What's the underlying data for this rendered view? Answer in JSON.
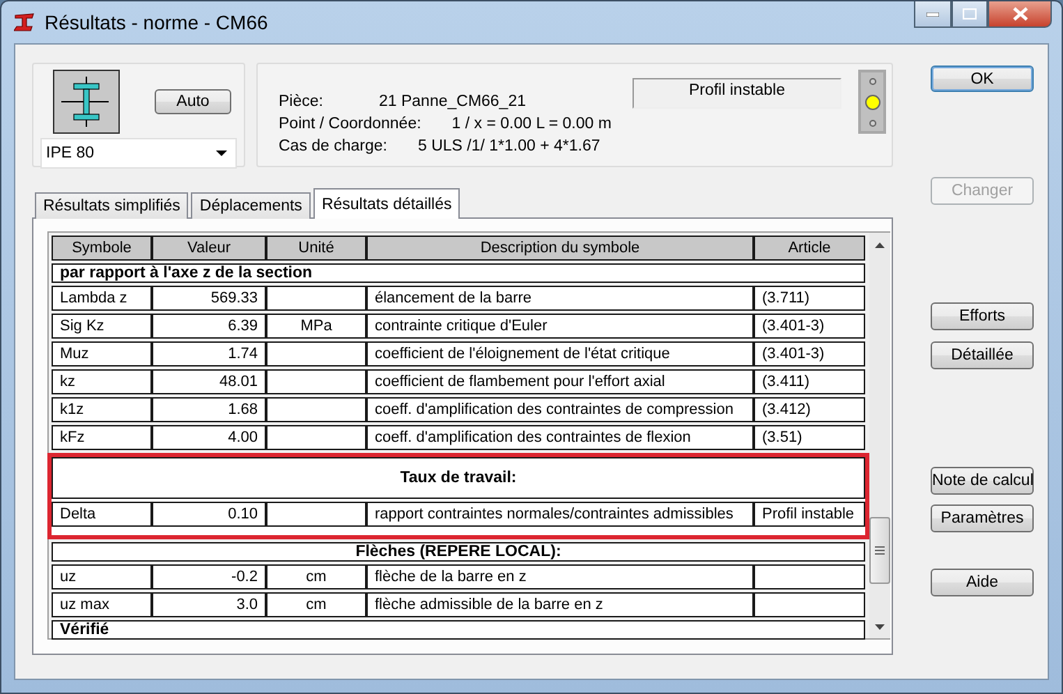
{
  "window": {
    "title": "Résultats - norme - CM66"
  },
  "section": {
    "profile": "IPE 80",
    "auto_button": "Auto"
  },
  "info": [
    {
      "label": "Pièce:",
      "value": "21  Panne_CM66_21"
    },
    {
      "label": "Point / Coordonnée:",
      "value": "1 / x = 0.00 L = 0.00 m"
    },
    {
      "label": "Cas de charge:",
      "value": "5 ULS /1/  1*1.00 + 4*1.67"
    }
  ],
  "status_text": "Profil instable",
  "indicator": [
    {
      "on": false
    },
    {
      "on": true
    },
    {
      "on": false
    }
  ],
  "tabs": [
    {
      "label": "Résultats simplifiés",
      "selected": false
    },
    {
      "label": "Déplacements",
      "selected": false
    },
    {
      "label": "Résultats détaillés",
      "selected": true
    }
  ],
  "table": {
    "columns": [
      "Symbole",
      "Valeur",
      "Unité",
      "Description du symbole",
      "Article"
    ],
    "rows": [
      {
        "kind": "section",
        "text": "par rapport à l'axe z de la section",
        "highlighted": false
      },
      {
        "kind": "data",
        "cells": [
          "Lambda z",
          "569.33",
          "",
          "élancement de la barre",
          "(3.711)"
        ],
        "highlighted": false
      },
      {
        "kind": "data",
        "cells": [
          "Sig Kz",
          "6.39",
          "MPa",
          "contrainte critique d'Euler",
          "(3.401-3)"
        ],
        "highlighted": false
      },
      {
        "kind": "data",
        "cells": [
          "Muz",
          "1.74",
          "",
          "coefficient de l'éloignement de l'état critique",
          "(3.401-3)"
        ],
        "highlighted": false
      },
      {
        "kind": "data",
        "cells": [
          "kz",
          "48.01",
          "",
          "coefficient de flambement pour l'effort axial",
          "(3.411)"
        ],
        "highlighted": false
      },
      {
        "kind": "data",
        "cells": [
          "k1z",
          "1.68",
          "",
          "coeff. d'amplification des contraintes de compression",
          "(3.412)"
        ],
        "highlighted": false
      },
      {
        "kind": "data",
        "cells": [
          "kFz",
          "4.00",
          "",
          "coeff. d'amplification des contraintes de flexion",
          "(3.51)"
        ],
        "highlighted": false
      },
      {
        "kind": "group",
        "text": "Taux de travail:",
        "highlighted": true
      },
      {
        "kind": "data",
        "cells": [
          "Delta",
          "0.10",
          "",
          "rapport contraintes normales/contraintes admissibles",
          "Profil instable"
        ],
        "highlighted": true
      },
      {
        "kind": "group",
        "text": "Flèches (REPERE LOCAL):",
        "highlighted": false
      },
      {
        "kind": "data",
        "cells": [
          "uz",
          "-0.2",
          "cm",
          "flèche de la barre en z",
          ""
        ],
        "highlighted": false
      },
      {
        "kind": "data",
        "cells": [
          "uz max",
          "3.0",
          "cm",
          "flèche admissible de la barre en z",
          ""
        ],
        "highlighted": false
      },
      {
        "kind": "section",
        "text": "Vérifié",
        "highlighted": false
      }
    ]
  },
  "buttons": [
    {
      "label": "OK",
      "kind": "default",
      "disabled": false
    },
    {
      "label": "Changer",
      "kind": "plain",
      "disabled": true
    },
    {
      "label": "Efforts",
      "kind": "plain",
      "disabled": false
    },
    {
      "label": "Détaillée",
      "kind": "plain",
      "disabled": false
    },
    {
      "label": "Note de calcul",
      "kind": "plain",
      "disabled": false
    },
    {
      "label": "Paramètres",
      "kind": "plain",
      "disabled": false
    },
    {
      "label": "Aide",
      "kind": "plain",
      "disabled": false
    }
  ]
}
